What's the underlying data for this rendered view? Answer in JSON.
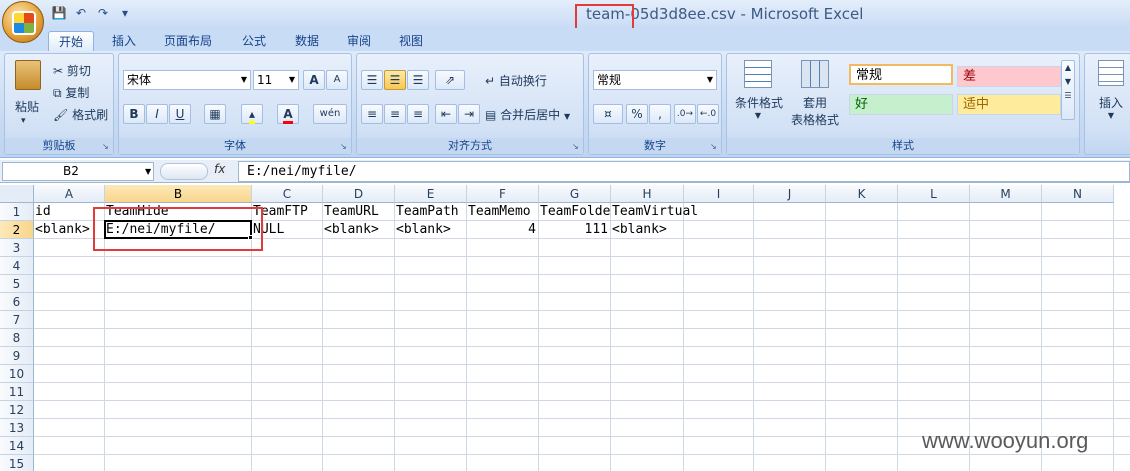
{
  "window": {
    "title": "team-05d3d8ee.csv - Microsoft Excel"
  },
  "quick_access": [
    "save-icon",
    "undo-icon",
    "redo-icon",
    "customize-icon"
  ],
  "tabs": [
    "开始",
    "插入",
    "页面布局",
    "公式",
    "数据",
    "审阅",
    "视图"
  ],
  "active_tab": "开始",
  "ribbon": {
    "clipboard": {
      "label": "剪贴板",
      "paste": "粘贴",
      "cut": "剪切",
      "copy": "复制",
      "format_painter": "格式刷"
    },
    "font": {
      "label": "字体",
      "font_name": "宋体",
      "font_size": "11",
      "grow": "A",
      "shrink": "A",
      "bold": "B",
      "italic": "I",
      "underline": "U",
      "font_color": "A",
      "phonetic": "wén"
    },
    "alignment": {
      "label": "对齐方式",
      "wrap_text": "自动换行",
      "merge_center": "合并后居中"
    },
    "number": {
      "label": "数字",
      "format": "常规",
      "percent": "%",
      "comma": ","
    },
    "styles": {
      "label": "样式",
      "conditional_format": "条件格式",
      "table_format_line1": "套用",
      "table_format_line2": "表格格式",
      "normal": "常规",
      "bad": "差",
      "good": "好",
      "neutral": "适中"
    },
    "cells": {
      "insert": "插入"
    }
  },
  "formula_bar": {
    "name_box": "B2",
    "fx": "fx",
    "value": "E:/nei/myfile/"
  },
  "sheet": {
    "columns": [
      "A",
      "B",
      "C",
      "D",
      "E",
      "F",
      "G",
      "H",
      "I",
      "J",
      "K",
      "L",
      "M",
      "N"
    ],
    "rows": [
      "1",
      "2",
      "3",
      "4",
      "5",
      "6",
      "7",
      "8",
      "9",
      "10",
      "11",
      "12",
      "13",
      "14",
      "15"
    ],
    "row1": [
      "id",
      "TeamHide",
      "TeamFTP",
      "TeamURL",
      "TeamPath",
      "TeamMemo",
      "TeamFolder",
      "TeamVirtual"
    ],
    "row2": [
      "<blank>",
      "E:/nei/myfile/",
      "NULL",
      "<blank>",
      "<blank>",
      "4",
      "111",
      "<blank>"
    ],
    "selected_cell": "B2"
  },
  "watermark": "www.wooyun.org",
  "colors": {
    "highlight_box": "#e23b3b",
    "ribbon_bg": "#c9dcf5",
    "bad_style_bg": "#ffc7ce",
    "good_style_bg": "#c6efce",
    "neutral_style_bg": "#ffeb9c"
  }
}
